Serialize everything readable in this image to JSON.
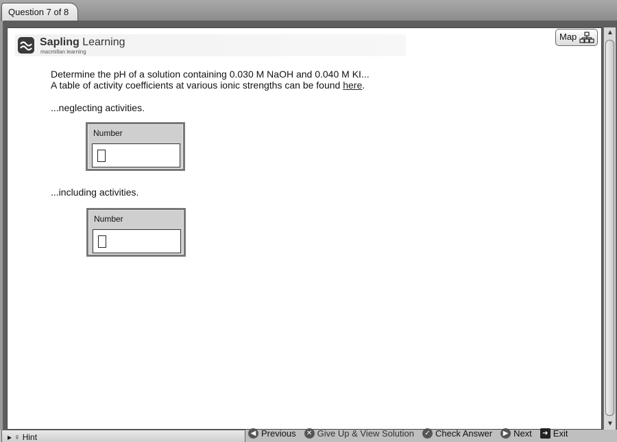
{
  "tab": {
    "label": "Question 7 of 8"
  },
  "logo": {
    "name_bold": "Sapling",
    "name_light": " Learning",
    "subtitle": "macmillan learning"
  },
  "map_button": {
    "label": "Map"
  },
  "question": {
    "line1": "Determine the pH of a solution containing 0.030 M NaOH and 0.040 M KI...",
    "line2_prefix": "A table of activity coefficients at various ionic strengths can be found ",
    "line2_link": "here",
    "line2_suffix": "."
  },
  "parts": [
    {
      "label": "...neglecting activities.",
      "field_label": "Number",
      "value": ""
    },
    {
      "label": "...including activities.",
      "field_label": "Number",
      "value": ""
    }
  ],
  "hint": {
    "label": "Hint"
  },
  "toolbar": {
    "previous": "Previous",
    "give_up": "Give Up & View Solution",
    "check": "Check Answer",
    "next": "Next",
    "exit": "Exit"
  },
  "icons": {
    "previous": "arrow-left-circle-icon",
    "give_up": "x-circle-icon",
    "check": "check-circle-icon",
    "next": "arrow-right-circle-icon",
    "exit": "exit-door-icon",
    "map": "sitemap-icon",
    "hint": "lightbulb-icon"
  }
}
